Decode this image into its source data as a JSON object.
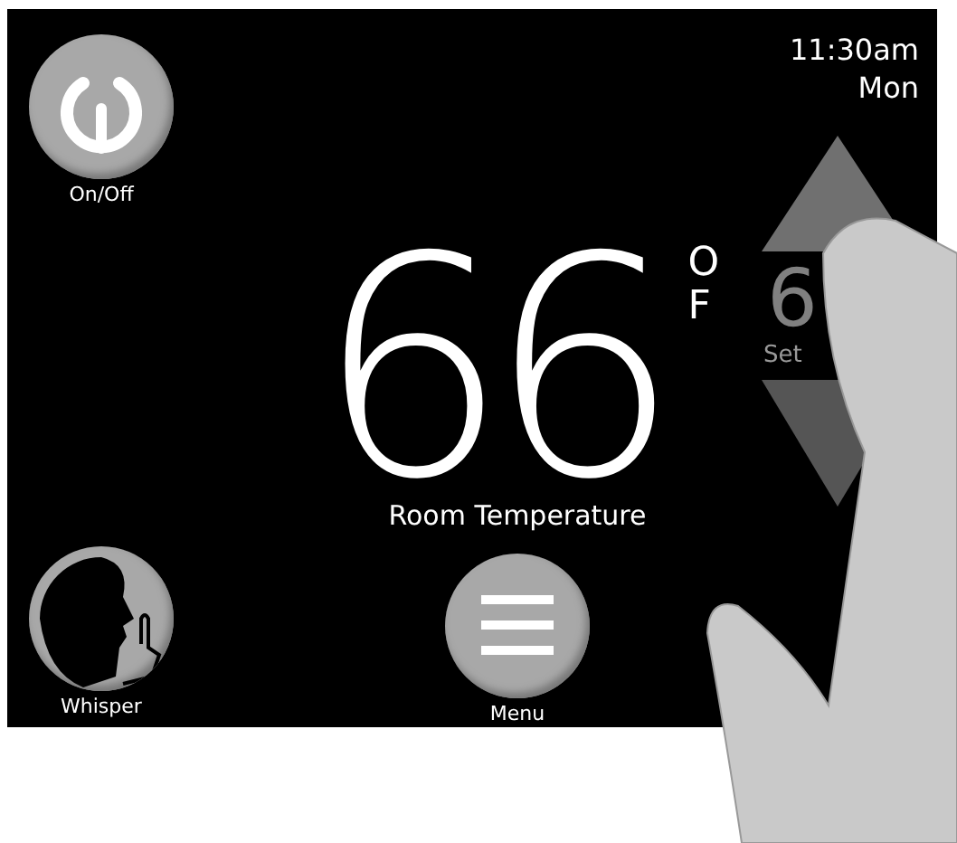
{
  "power_button": {
    "label": "On/Off"
  },
  "clock": {
    "time": "11:30am",
    "day": "Mon"
  },
  "room_temperature": {
    "value": "66",
    "degree": "O",
    "unit": "F",
    "label": "Room Temperature"
  },
  "setpoint": {
    "value": "6",
    "label": "Set"
  },
  "buttons": [
    {
      "kind": "whisper",
      "label": "Whisper"
    },
    {
      "kind": "menu",
      "label": "Menu"
    }
  ]
}
